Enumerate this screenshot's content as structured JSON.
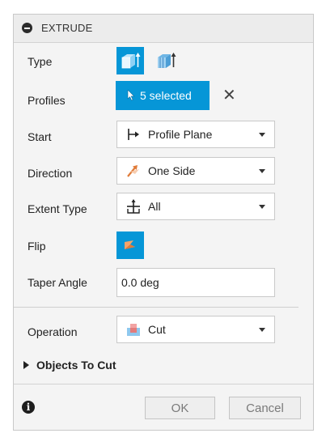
{
  "header": {
    "title": "EXTRUDE",
    "collapse_icon": "minus-circle-icon"
  },
  "rows": {
    "type": {
      "label": "Type",
      "options": [
        "one-side-extrude-icon",
        "thin-extrude-icon"
      ],
      "selected": 0
    },
    "profiles": {
      "label": "Profiles",
      "button_text": "5 selected",
      "clear_icon": "close-icon",
      "clear_text": "✕"
    },
    "start": {
      "label": "Start",
      "value": "Profile Plane",
      "icon": "profile-plane-icon"
    },
    "direction": {
      "label": "Direction",
      "value": "One Side",
      "icon": "one-side-direction-icon"
    },
    "extent_type": {
      "label": "Extent Type",
      "value": "All",
      "icon": "extent-all-icon"
    },
    "flip": {
      "label": "Flip",
      "icon": "flip-icon"
    },
    "taper_angle": {
      "label": "Taper Angle",
      "value": "0.0 deg"
    },
    "operation": {
      "label": "Operation",
      "value": "Cut",
      "icon": "cut-icon"
    }
  },
  "objects_to_cut": {
    "label": "Objects To Cut"
  },
  "footer": {
    "info_icon": "info-icon",
    "info_text": "i",
    "ok_label": "OK",
    "cancel_label": "Cancel"
  },
  "colors": {
    "accent": "#0696d7",
    "panel_bg": "#f4f4f4",
    "header_bg": "#ececec"
  }
}
